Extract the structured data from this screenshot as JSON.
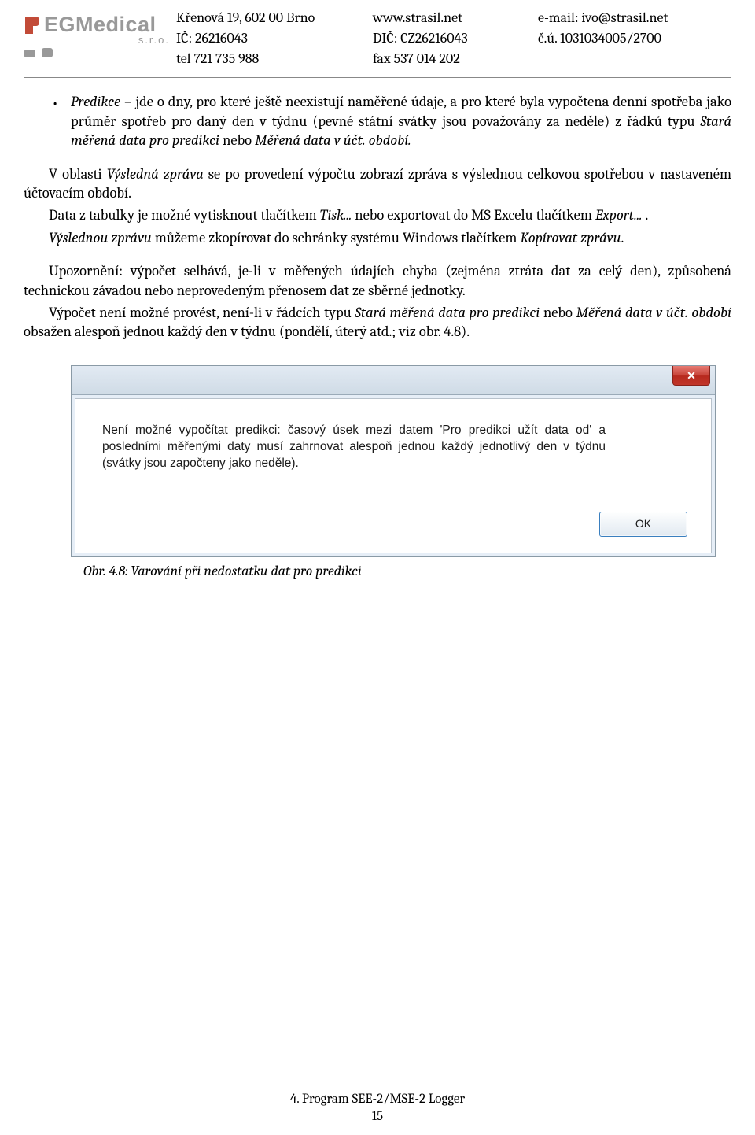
{
  "header": {
    "logo_text": "EGMedical",
    "logo_sro": "s.r.o.",
    "col1": {
      "l1": "Křenová 19, 602 00 Brno",
      "l2": "IČ: 26216043",
      "l3": "tel 721 735 988"
    },
    "col2": {
      "l1": "www.strasil.net",
      "l2": "DIČ: CZ26216043",
      "l3": "fax 537 014 202"
    },
    "col3": {
      "l1": "e-mail: ivo@strasil.net",
      "l2": "č.ú. 1031034005/2700"
    }
  },
  "body": {
    "bullet": {
      "pre": "Predikce",
      "text": " – jde o dny, pro které ještě neexistují naměřené údaje, a pro které byla vypočtena denní spotřeba jako průměr spotřeb pro daný den v týdnu (pevné státní svátky jsou považovány za neděle) z řádků typu ",
      "it1": "Stará měřená data pro predikci",
      "mid": " nebo ",
      "it2": "Měřená data v účt. období."
    },
    "p1": {
      "a": "V oblasti ",
      "it": "Výsledná zpráva",
      "b": " se po provedení výpočtu zobrazí zpráva s výslednou celkovou spotřebou v nastaveném účtovacím období."
    },
    "p2": {
      "a": "Data z tabulky je možné vytisknout tlačítkem ",
      "it1": "Tisk...",
      "b": " nebo exportovat do MS Excelu tlačítkem ",
      "it2": "Export...",
      "c": " ."
    },
    "p3": {
      "it1": "Výslednou zprávu",
      "a": " můžeme zkopírovat do schránky systému Windows tlačítkem ",
      "it2": "Kopírovat zprávu",
      "b": "."
    },
    "p4": "Upozornění: výpočet selhává, je-li v měřených údajích chyba (zejména ztráta dat za celý den), způsobená technickou závadou nebo neprovedeným přenosem dat ze sběrné jednotky.",
    "p5": {
      "a": "Výpočet není možné provést, není-li v řádcích typu ",
      "it1": "Stará měřená data pro predikci",
      "b": " nebo ",
      "it2": "Měřená data v účt. období",
      "c": " obsažen alespoň jednou každý den v týdnu (pondělí, úterý atd.; viz obr. 4.8)."
    }
  },
  "dialog": {
    "close": "✕",
    "msg": "Není možné vypočítat predikci: časový úsek mezi datem 'Pro predikci užít data od' a posledními měřenými daty musí zahrnovat alespoň jednou každý jednotlivý den v týdnu (svátky jsou započteny jako neděle).",
    "ok": "OK"
  },
  "caption": "Obr. 4.8: Varování při nedostatku dat pro predikci",
  "footer": {
    "l1": "4. Program SEE-2/MSE-2 Logger",
    "l2": "15"
  }
}
